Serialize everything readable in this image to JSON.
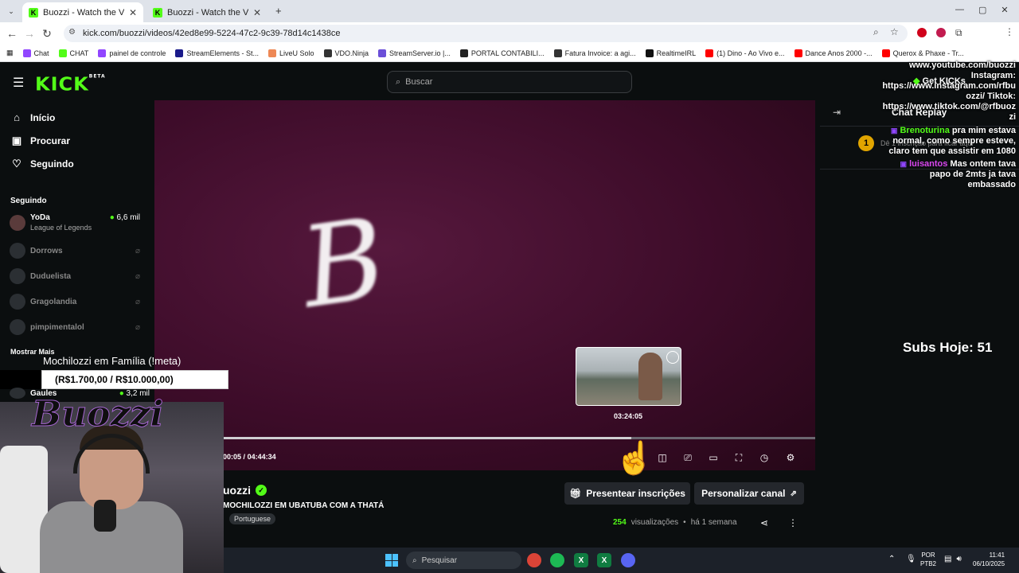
{
  "browser": {
    "tabs": [
      {
        "title": "Buozzi - Watch the VOD on Kic",
        "active": true
      },
      {
        "title": "Buozzi - Watch the VOD on Kic",
        "active": false
      }
    ],
    "url": "kick.com/buozzi/videos/42ed8e99-5224-47c2-9c39-78d14c1438ce",
    "bookmarks": [
      "Chat",
      "CHAT",
      "painel de controle",
      "StreamElements - St...",
      "LiveU Solo",
      "VDO.Ninja",
      "StreamServer.io |...",
      "PORTAL CONTABILI...",
      "Fatura Invoice: a agi...",
      "RealtimeIRL",
      "(1) Dino - Ao Vivo e...",
      "Dance Anos 2000 -...",
      "Querox & Phaxe - Tr..."
    ],
    "bookmark_colors": [
      "#9146ff",
      "#53fc18",
      "#9146ff",
      "#1a1a8a",
      "#e85",
      "#333",
      "#6b4fd8",
      "#222",
      "#333",
      "#111",
      "#f00",
      "#f00",
      "#f00"
    ]
  },
  "header": {
    "logo": "KICK",
    "logo_badge": "BETA",
    "search_placeholder": "Buscar"
  },
  "sidebar": {
    "nav": [
      {
        "label": "Início",
        "icon": "home-icon"
      },
      {
        "label": "Procurar",
        "icon": "browse-icon"
      },
      {
        "label": "Seguindo",
        "icon": "heart-icon"
      }
    ],
    "following_title": "Seguindo",
    "following": [
      {
        "name": "YoDa",
        "sub": "League of Legends",
        "viewers": "6,6 mil",
        "live": true
      },
      {
        "name": "Dorrows",
        "live": false
      },
      {
        "name": "Duduelista",
        "live": false
      },
      {
        "name": "Gragolandia",
        "live": false
      },
      {
        "name": "pimpimentalol",
        "live": false
      }
    ],
    "show_more": "Mostrar Mais",
    "gaules": {
      "name": "Gaules",
      "viewers": "3,2 mil"
    }
  },
  "overlay": {
    "goal_name": "Mochilozzi em Família (!meta)",
    "goal_value": "(R$1.700,00 / R$10.000,00)",
    "webcam_logo": "Buozzi",
    "top_right_lines": [
      "www.youtube.com/buozzi",
      "Instagram:",
      "https://www.instagram.com/rfbu",
      "ozzi/ Tiktok:",
      "https://www.tiktok.com/@rfbuoz",
      "zi"
    ],
    "subs_today": "Subs Hoje: 51",
    "get_kicks": "Get KICKs"
  },
  "player": {
    "thumbnail_time": "03:24:05",
    "current_time": "00:05",
    "separator": "/",
    "duration": "04:44:34",
    "progress_fraction": 0.69
  },
  "video_info": {
    "channel": "uozzi",
    "title": "MOCHILOZZI EM UBATUBA COM A THATÁ",
    "language": "Portuguese",
    "gift_button": "Presentear inscrições",
    "customize_button": "Personalizar canal",
    "views_count": "254",
    "views_label": "visualizações",
    "date": "há 1 semana"
  },
  "chat": {
    "title": "Chat Replay",
    "gift_rank": "1",
    "gift_text": "Dê 1 inscrição para ficar aqui",
    "messages": [
      {
        "user": "Brenoturina",
        "user_color": "#53fc18",
        "text": "pra mim estava normal, como sempre esteve, claro tem que assistir em 1080"
      },
      {
        "user": "luisantos",
        "user_color": "#d946ef",
        "text": "Mas ontem tava papo de 2mts ja tava embassado"
      }
    ]
  },
  "taskbar": {
    "search_placeholder": "Pesquisar",
    "lang_line1": "POR",
    "lang_line2": "PTB2",
    "time": "11:41",
    "date": "06/10/2025"
  }
}
